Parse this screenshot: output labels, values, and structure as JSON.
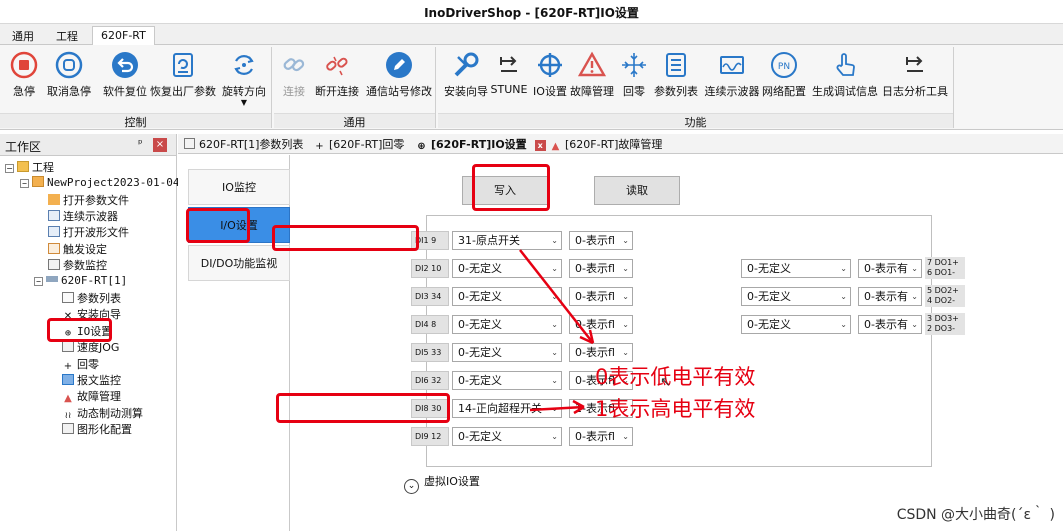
{
  "window": {
    "title": "InoDriverShop - [620F-RT]IO设置"
  },
  "menu_tabs": [
    "通用",
    "工程",
    "620F-RT"
  ],
  "ribbon": {
    "groups": {
      "control": "控制",
      "general": "通用",
      "function": "功能"
    },
    "buttons": {
      "estop": "急停",
      "cancel_estop": "取消急停",
      "soft_reset": "软件复位",
      "factory_reset": "恢复出厂参数",
      "rotate_dir": "旋转方向",
      "connect": "连接",
      "disconnect": "断开连接",
      "station_modify": "通信站号修改",
      "install_wizard": "安装向导",
      "stune": "STUNE",
      "io_settings": "IO设置",
      "fault_mgmt": "故障管理",
      "homing": "回零",
      "param_list": "参数列表",
      "continuous_scope": "连续示波器",
      "network_config": "网络配置",
      "debug_info": "生成调试信息",
      "log_tool": "日志分析工具"
    }
  },
  "workspace": {
    "title": "工作区",
    "pin": "ᵖ",
    "close": "×",
    "tree": {
      "root": "工程",
      "project": "NewProject2023-01-04",
      "open_param": "打开参数文件",
      "cont_scope": "连续示波器",
      "open_wave": "打开波形文件",
      "trigger": "触发设定",
      "param_monitor": "参数监控",
      "device": "620F-RT[1]",
      "param_list": "参数列表",
      "install_wizard": "安装向导",
      "io_settings": "IO设置",
      "speed_jog": "速度JOG",
      "homing": "回零",
      "msg_monitor": "报文监控",
      "fault_mgmt": "故障管理",
      "dyn_brake": "动态制动测算",
      "graph_config": "图形化配置"
    }
  },
  "doc_tabs": {
    "param_list": "620F-RT[1]参数列表",
    "homing": "[620F-RT]回零",
    "io_settings": "[620F-RT]IO设置",
    "fault_mgmt": "[620F-RT]故障管理",
    "close": "x"
  },
  "side_tabs": {
    "io_monitor": "IO监控",
    "io_settings": "I/O设置",
    "dido_monitor": "DI/DO功能监视"
  },
  "actions": {
    "write": "写入",
    "read": "读取"
  },
  "di_rows": [
    {
      "label": "DI1 9",
      "func": "31-原点开关",
      "level": "0-表示fl"
    },
    {
      "label": "DI2 10",
      "func": "0-无定义",
      "level": "0-表示fl"
    },
    {
      "label": "DI3 34",
      "func": "0-无定义",
      "level": "0-表示fl"
    },
    {
      "label": "DI4 8",
      "func": "0-无定义",
      "level": "0-表示fl"
    },
    {
      "label": "DI5 33",
      "func": "0-无定义",
      "level": "0-表示fl"
    },
    {
      "label": "DI6 32",
      "func": "0-无定义",
      "level": "0-表示fl"
    },
    {
      "label": "DI8 30",
      "func": "14-正向超程开关",
      "level": "1-表示fl"
    },
    {
      "label": "DI9 12",
      "func": "0-无定义",
      "level": "0-表示fl"
    }
  ],
  "do_rows": [
    {
      "func": "0-无定义",
      "level": "0-表示有",
      "label": "7 DO1+\n6 DO1-"
    },
    {
      "func": "0-无定义",
      "level": "0-表示有",
      "label": "5 DO2+\n4 DO2-"
    },
    {
      "func": "0-无定义",
      "level": "0-表示有",
      "label": "3 DO3+\n2 DO3-"
    }
  ],
  "virtual_io": {
    "label": "虚拟IO设置",
    "icon": "⌄"
  },
  "annotations": {
    "low": "0表示低电平有效",
    "high": "1表示高电平有效"
  },
  "watermark": "CSDN @大小曲奇(´ε｀ )",
  "colors": {
    "highlight": "#e60012",
    "active_tab": "#3a8ee6"
  }
}
